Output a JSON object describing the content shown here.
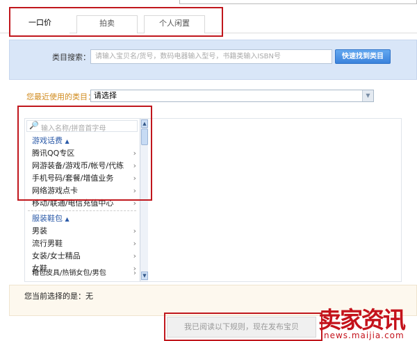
{
  "tabs": [
    {
      "label": "一口价",
      "active": true
    },
    {
      "label": "拍卖"
    },
    {
      "label": "个人闲置"
    }
  ],
  "category_search": {
    "label": "类目搜索：",
    "placeholder": "请输入宝贝名/货号，数码电器输入型号，书籍类输入ISBN号",
    "button": "快速找到类目"
  },
  "recent": {
    "label": "您最近使用的类目：",
    "selected": "请选择"
  },
  "category_list": {
    "search_placeholder": "输入名称/拼音首字母",
    "groups": [
      {
        "title": "游戏话费",
        "items": [
          "腾讯QQ专区",
          "网游装备/游戏币/帐号/代练",
          "手机号码/套餐/增值业务",
          "网络游戏点卡",
          "移动/联通/电信充值中心"
        ]
      },
      {
        "title": "服装鞋包",
        "items": [
          "男装",
          "流行男鞋",
          "女装/女士精品",
          "女鞋",
          "箱包皮具/热销女包/男包"
        ]
      }
    ]
  },
  "current_selection": {
    "label": "您当前选择的是：",
    "value": "无"
  },
  "submit_button": "我已阅读以下规则，现在发布宝贝",
  "watermark": {
    "brand": "卖家资讯",
    "url": "news.maijia.com"
  },
  "colors": {
    "highlight_box": "#c0161c",
    "accent_blue": "#3a82dc",
    "group_title": "#2b5aa8",
    "recent_label": "#d08a1c"
  }
}
